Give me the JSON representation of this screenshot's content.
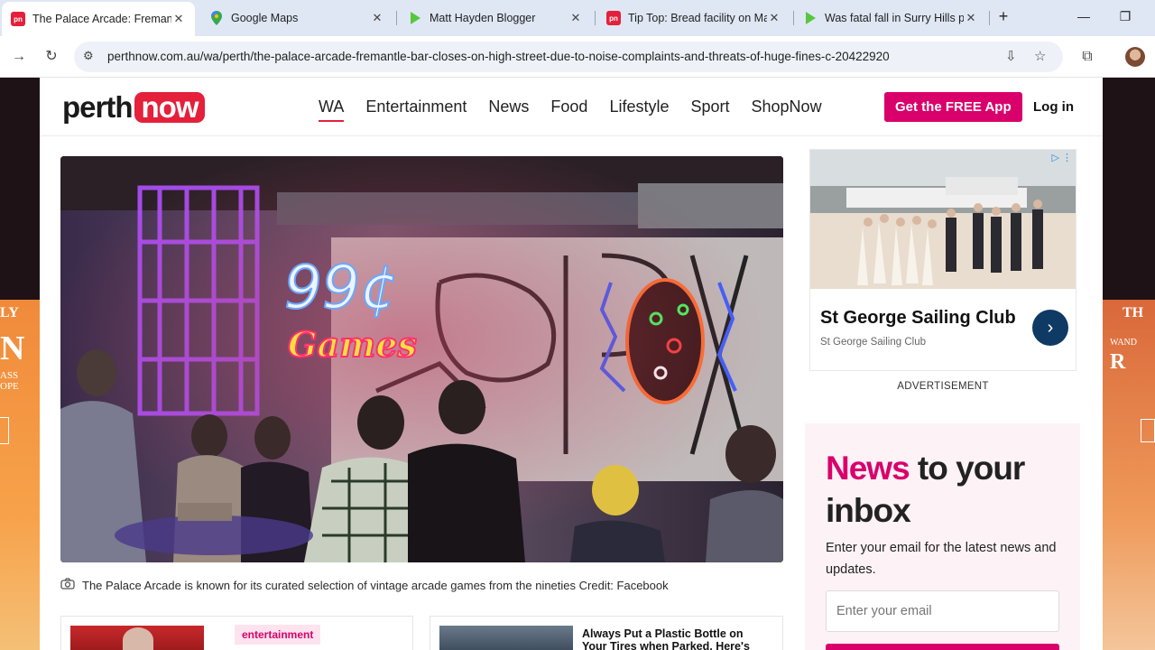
{
  "browser": {
    "tabs": [
      {
        "title": "The Palace Arcade: Fremantl",
        "favicon": "pn",
        "favicon_color": "#e4203a",
        "active": true
      },
      {
        "title": "Google Maps",
        "favicon": "maps-pin",
        "favicon_color": "#34a853",
        "active": false
      },
      {
        "title": "Matt Hayden Blogger",
        "favicon": "play",
        "favicon_color": "#57c73f",
        "active": false
      },
      {
        "title": "Tip Top: Bread facility on Ma",
        "favicon": "pn",
        "favicon_color": "#e4203a",
        "active": false
      },
      {
        "title": "Was fatal fall in Surry Hills p",
        "favicon": "play",
        "favicon_color": "#57c73f",
        "active": false
      }
    ],
    "url": "perthnow.com.au/wa/perth/the-palace-arcade-fremantle-bar-closes-on-high-street-due-to-noise-complaints-and-threats-of-huge-fines-c-20422920"
  },
  "site": {
    "logo_left": "perth",
    "logo_right": "now",
    "nav": [
      {
        "label": "WA",
        "active": true
      },
      {
        "label": "Entertainment"
      },
      {
        "label": "News"
      },
      {
        "label": "Food"
      },
      {
        "label": "Lifestyle"
      },
      {
        "label": "Sport"
      },
      {
        "label": "ShopNow"
      }
    ],
    "cta": "Get the FREE App",
    "login": "Log in",
    "brand_color": "#d9006c"
  },
  "article": {
    "caption": "The Palace Arcade is known for its curated selection of vintage arcade games from the nineties Credit: Facebook",
    "hero_sign_1": "99¢",
    "hero_sign_2": "Games"
  },
  "cards": [
    {
      "tag": "entertainment"
    },
    {
      "title": "Always Put a Plastic Bottle on Your Tires when Parked, Here's Why"
    }
  ],
  "ad": {
    "title": "St George Sailing Club",
    "sub": "St George Sailing Club",
    "label": "ADVERTISEMENT"
  },
  "newsletter": {
    "title_pink": "News",
    "title_rest": " to your inbox",
    "desc": "Enter your email for the latest news and updates.",
    "placeholder": "Enter your email"
  },
  "skins": {
    "left_lines": [
      "LY",
      "N",
      "ASS",
      "OPE"
    ],
    "right_lines": [
      "TH",
      "WAND",
      "R"
    ]
  }
}
